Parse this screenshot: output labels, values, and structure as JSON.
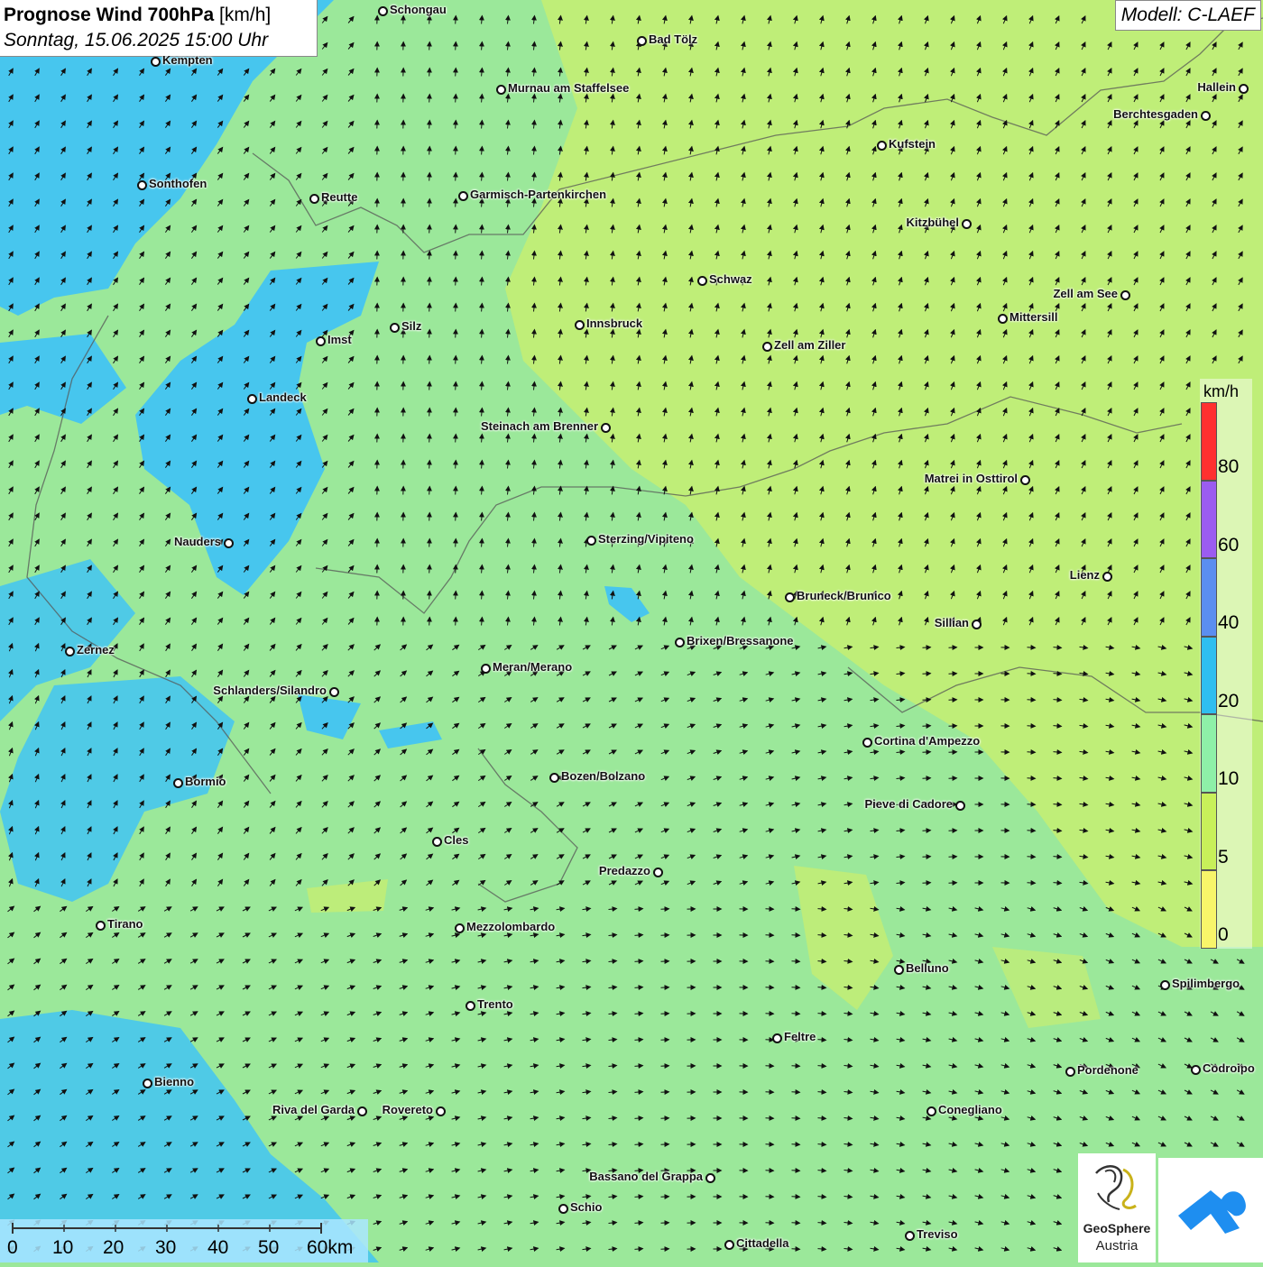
{
  "title": {
    "bold": "Prognose Wind 700hPa",
    "unit": "[km/h]",
    "datetime": "Sonntag, 15.06.2025 15:00 Uhr"
  },
  "model": "Modell: C-LAEF",
  "legend": {
    "unit": "km/h",
    "labels": [
      "80",
      "60",
      "40",
      "20",
      "10",
      "5",
      "0"
    ],
    "colors": [
      "#ff3030",
      "#9b5cf0",
      "#5b8ef0",
      "#2fbef0",
      "#8ef0a8",
      "#c8f05a",
      "#f8f56a"
    ]
  },
  "scalebar": {
    "labels": [
      "0",
      "10",
      "20",
      "30",
      "40",
      "50",
      "60km"
    ]
  },
  "logo": {
    "name_line1": "GeoSphere",
    "name_line2": "Austria"
  },
  "cities": [
    {
      "name": "Schongau"
    },
    {
      "name": "Bad Tölz"
    },
    {
      "name": "Kempten"
    },
    {
      "name": "Murnau am Staffelsee"
    },
    {
      "name": "Hallein"
    },
    {
      "name": "Berchtesgaden"
    },
    {
      "name": "Kufstein"
    },
    {
      "name": "Sonthofen"
    },
    {
      "name": "Reutte"
    },
    {
      "name": "Garmisch-Partenkirchen"
    },
    {
      "name": "Kitzbühel"
    },
    {
      "name": "Schwaz"
    },
    {
      "name": "Zell am See"
    },
    {
      "name": "Mittersill"
    },
    {
      "name": "Silz"
    },
    {
      "name": "Innsbruck"
    },
    {
      "name": "Imst"
    },
    {
      "name": "Zell am Ziller"
    },
    {
      "name": "Landeck"
    },
    {
      "name": "Steinach am Brenner"
    },
    {
      "name": "Matrei in Osttirol"
    },
    {
      "name": "Nauders"
    },
    {
      "name": "Sterzing/Vipiteno"
    },
    {
      "name": "Lienz"
    },
    {
      "name": "Bruneck/Brunico"
    },
    {
      "name": "Sillian"
    },
    {
      "name": "Zernez"
    },
    {
      "name": "Brixen/Bressanone"
    },
    {
      "name": "Meran/Merano"
    },
    {
      "name": "Schlanders/Silandro"
    },
    {
      "name": "Cortina d'Ampezzo"
    },
    {
      "name": "Bozen/Bolzano"
    },
    {
      "name": "Bormio"
    },
    {
      "name": "Pieve di Cadore"
    },
    {
      "name": "Cles"
    },
    {
      "name": "Predazzo"
    },
    {
      "name": "Tirano"
    },
    {
      "name": "Mezzolombardo"
    },
    {
      "name": "Belluno"
    },
    {
      "name": "Spilimbergo"
    },
    {
      "name": "Trento"
    },
    {
      "name": "Feltre"
    },
    {
      "name": "Bienno"
    },
    {
      "name": "Pordenone"
    },
    {
      "name": "Codroipo"
    },
    {
      "name": "Riva del Garda"
    },
    {
      "name": "Rovereto"
    },
    {
      "name": "Conegliano"
    },
    {
      "name": "Bassano del Grappa"
    },
    {
      "name": "Schio"
    },
    {
      "name": "Treviso"
    },
    {
      "name": "Cittadella"
    }
  ]
}
